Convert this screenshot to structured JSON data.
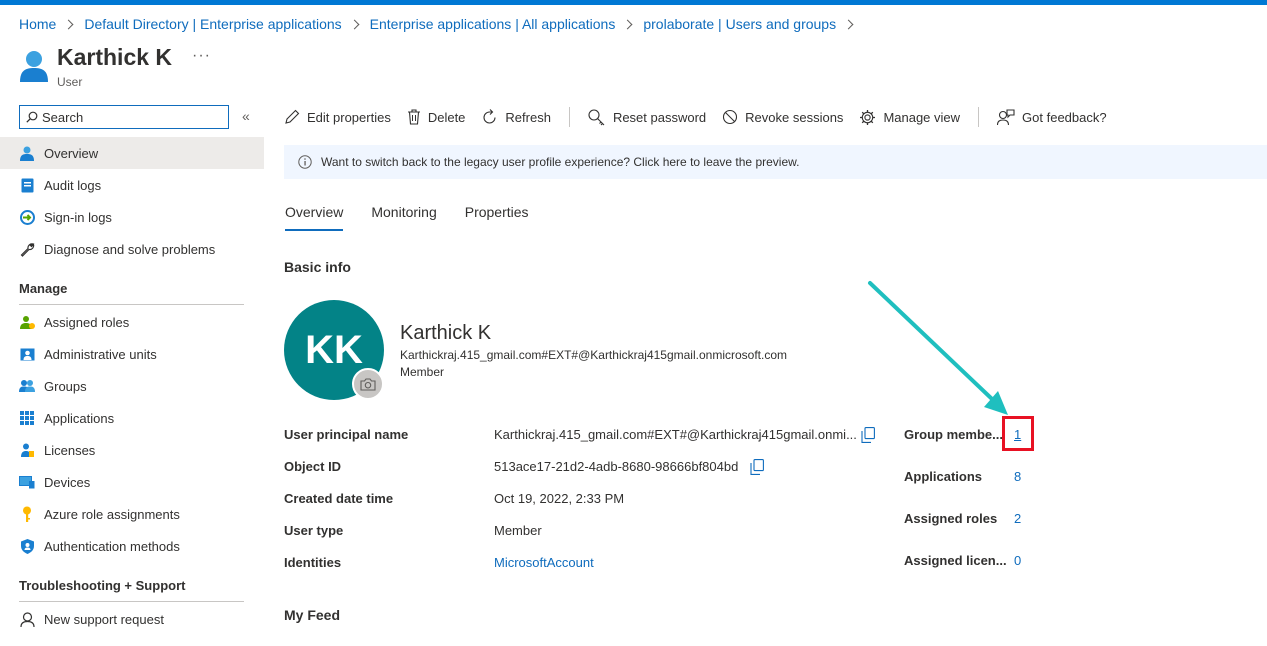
{
  "breadcrumb": [
    "Home",
    "Default Directory | Enterprise applications",
    "Enterprise applications | All applications",
    "prolaborate | Users and groups"
  ],
  "header": {
    "title": "Karthick K",
    "subtitle": "User",
    "more": "···"
  },
  "sidebar": {
    "search_placeholder": "Search",
    "collapse": "«",
    "top_items": [
      "Overview",
      "Audit logs",
      "Sign-in logs",
      "Diagnose and solve problems"
    ],
    "manage_heading": "Manage",
    "manage_items": [
      "Assigned roles",
      "Administrative units",
      "Groups",
      "Applications",
      "Licenses",
      "Devices",
      "Azure role assignments",
      "Authentication methods"
    ],
    "support_heading": "Troubleshooting + Support",
    "support_items": [
      "New support request"
    ]
  },
  "toolbar": {
    "edit": "Edit properties",
    "delete": "Delete",
    "refresh": "Refresh",
    "reset_password": "Reset password",
    "revoke_sessions": "Revoke sessions",
    "manage_view": "Manage view",
    "feedback": "Got feedback?"
  },
  "banner": {
    "text": "Want to switch back to the legacy user profile experience? Click here to leave the preview."
  },
  "tabs": [
    "Overview",
    "Monitoring",
    "Properties"
  ],
  "basic_info": {
    "heading": "Basic info",
    "initials": "KK",
    "name": "Karthick K",
    "email": "Karthickraj.415_gmail.com#EXT#@Karthickraj415gmail.onmicrosoft.com",
    "user_type": "Member"
  },
  "properties": {
    "upn_label": "User principal name",
    "upn_value": "Karthickraj.415_gmail.com#EXT#@Karthickraj415gmail.onmi...",
    "object_id_label": "Object ID",
    "object_id_value": "513ace17-21d2-4adb-8680-98666bf804bd",
    "created_label": "Created date time",
    "created_value": "Oct 19, 2022, 2:33 PM",
    "type_label": "User type",
    "type_value": "Member",
    "identities_label": "Identities",
    "identities_value": "MicrosoftAccount"
  },
  "stats": {
    "groups_label": "Group membe...",
    "groups_value": "1",
    "apps_label": "Applications",
    "apps_value": "8",
    "roles_label": "Assigned roles",
    "roles_value": "2",
    "licenses_label": "Assigned licen...",
    "licenses_value": "0"
  },
  "my_feed": "My Feed",
  "colors": {
    "accent": "#0f6cbd",
    "avatar": "#038387",
    "highlight": "#e81123",
    "arrow": "#1fbfbf",
    "topbar": "#0078d4"
  }
}
